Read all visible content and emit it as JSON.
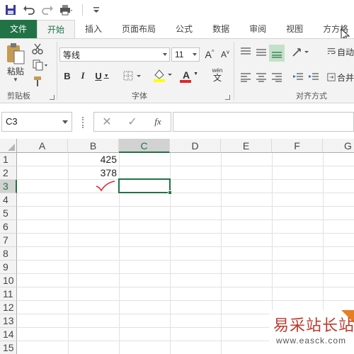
{
  "quick_access": {
    "icons": [
      "save-icon",
      "undo-icon",
      "redo-icon",
      "print-preview-icon",
      "customize-icon"
    ]
  },
  "tabs": [
    {
      "label": "文件"
    },
    {
      "label": "开始"
    },
    {
      "label": "插入"
    },
    {
      "label": "页面布局"
    },
    {
      "label": "公式"
    },
    {
      "label": "数据"
    },
    {
      "label": "审阅"
    },
    {
      "label": "视图"
    },
    {
      "label": "方方格"
    }
  ],
  "ribbon": {
    "clipboard": {
      "paste_label": "粘贴",
      "group_label": "剪贴板"
    },
    "font": {
      "font_name": "等线",
      "font_size": "11",
      "grow_label": "A",
      "shrink_label": "A",
      "bold": "B",
      "italic": "I",
      "underline": "U",
      "font_color_label": "A",
      "wen_label": "wén",
      "wen_char": "文",
      "group_label": "字体"
    },
    "alignment": {
      "group_label": "对齐方式",
      "wrap_label": "自动",
      "merge_label": "合并"
    }
  },
  "formula_bar": {
    "name_box": "C3",
    "fx_label": "fx",
    "content": ""
  },
  "sheet": {
    "columns": [
      "A",
      "B",
      "C",
      "D",
      "E",
      "F",
      "G"
    ],
    "selected_column": "C",
    "rows": [
      "1",
      "2",
      "3",
      "4",
      "5",
      "6",
      "7",
      "8",
      "9",
      "10",
      "11",
      "12",
      "13",
      "14",
      "15"
    ],
    "selected_row": "3",
    "cells": {
      "B1": "425",
      "B2": "378"
    },
    "annotation": "checkmark"
  },
  "watermark": {
    "title": "易采站长站",
    "url": "www.easck.com"
  },
  "colors": {
    "accent": "#217346",
    "checkmark": "#e0262e"
  }
}
